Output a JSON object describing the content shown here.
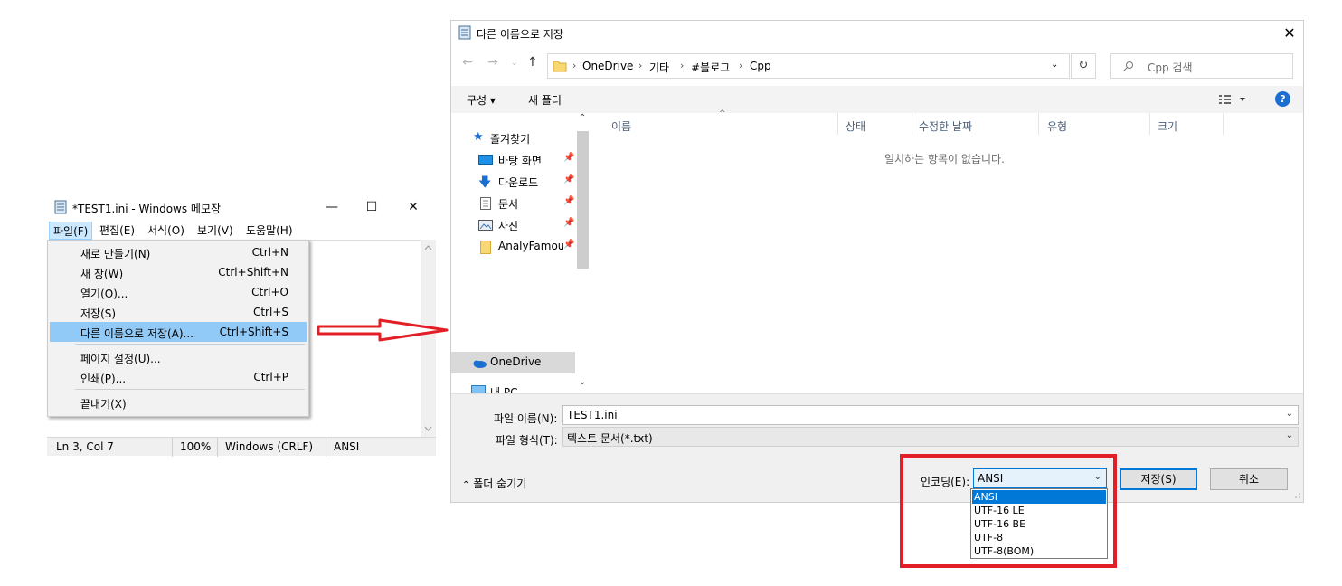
{
  "notepad": {
    "title": "*TEST1.ini - Windows 메모장",
    "window_buttons": {
      "minimize": "—",
      "maximize": "☐",
      "close": "✕"
    },
    "menu": [
      "파일(F)",
      "편집(E)",
      "서식(O)",
      "보기(V)",
      "도움말(H)"
    ],
    "status": {
      "position": "Ln 3, Col 7",
      "zoom": "100%",
      "line_ending": "Windows (CRLF)",
      "encoding": "ANSI"
    }
  },
  "file_menu": {
    "items": [
      {
        "label": "새로 만들기(N)",
        "shortcut": "Ctrl+N"
      },
      {
        "label": "새 창(W)",
        "shortcut": "Ctrl+Shift+N"
      },
      {
        "label": "열기(O)...",
        "shortcut": "Ctrl+O"
      },
      {
        "label": "저장(S)",
        "shortcut": "Ctrl+S"
      },
      {
        "label": "다른 이름으로 저장(A)...",
        "shortcut": "Ctrl+Shift+S"
      },
      {
        "label": "페이지 설정(U)...",
        "shortcut": ""
      },
      {
        "label": "인쇄(P)...",
        "shortcut": "Ctrl+P"
      },
      {
        "label": "끝내기(X)",
        "shortcut": ""
      }
    ]
  },
  "dialog": {
    "title": "다른 이름으로 저장",
    "close": "✕",
    "breadcrumb": [
      "OneDrive",
      "기타",
      "#블로그",
      "Cpp"
    ],
    "search_placeholder": "Cpp 검색",
    "toolbar": {
      "organize": "구성 ▾",
      "new_folder": "새 폴더",
      "help": "?"
    },
    "nav": {
      "quick_access": "즐겨찾기",
      "items": [
        "바탕 화면",
        "다운로드",
        "문서",
        "사진",
        "AnalyFamoul"
      ],
      "onedrive": "OneDrive",
      "this_pc": "내 PC"
    },
    "columns": [
      "이름",
      "상태",
      "수정한 날짜",
      "유형",
      "크기"
    ],
    "empty_message": "일치하는 항목이 없습니다.",
    "filename_label": "파일 이름(N):",
    "filename_value": "TEST1.ini",
    "filetype_label": "파일 형식(T):",
    "filetype_value": "텍스트 문서(*.txt)",
    "hide_folders": "폴더 숨기기",
    "encoding_label": "인코딩(E):",
    "encoding_value": "ANSI",
    "save_button": "저장(S)",
    "cancel_button": "취소",
    "encoding_options": [
      "ANSI",
      "UTF-16 LE",
      "UTF-16 BE",
      "UTF-8",
      "UTF-8(BOM)"
    ]
  },
  "colors": {
    "highlight_red": "#e21f26",
    "selection_blue": "#0078d7",
    "menu_highlight": "#91c9f7"
  }
}
